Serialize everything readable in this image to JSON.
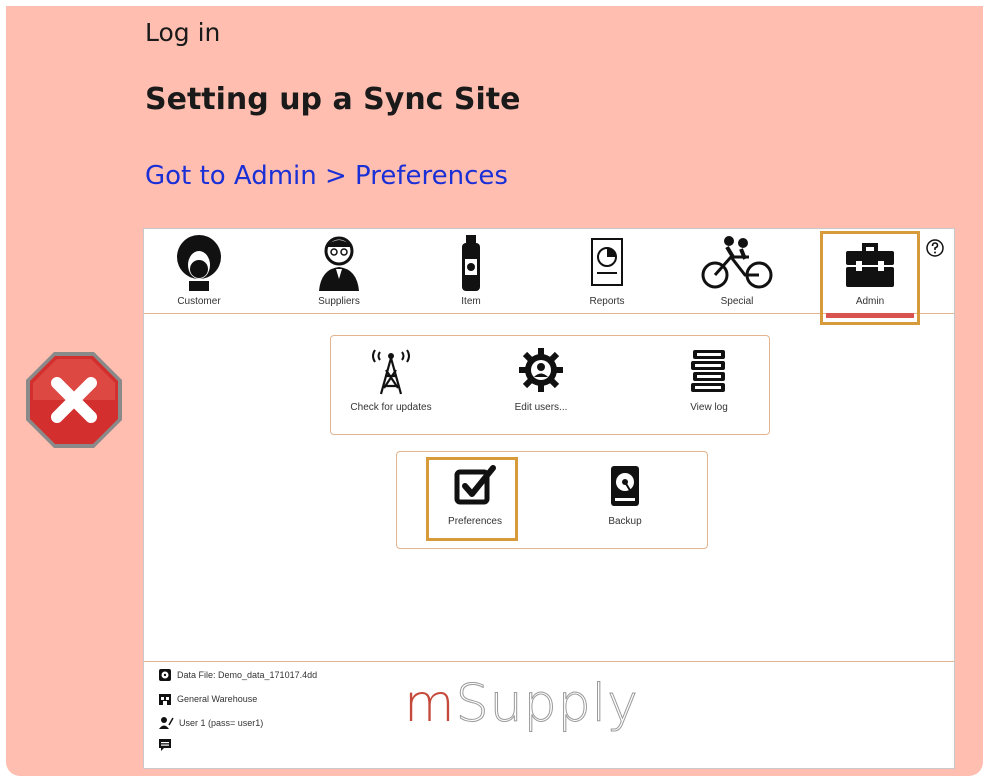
{
  "notice": {
    "title": "Log in",
    "heading": "Setting up a Sync Site",
    "link_text": "Got to Admin > Preferences",
    "colors": {
      "background": "#ffbeb0",
      "link": "#1a2fd6",
      "error": "#d32f2f"
    }
  },
  "app": {
    "toolbar": {
      "items": [
        {
          "label": "Customer",
          "icon": "customer-icon"
        },
        {
          "label": "Suppliers",
          "icon": "suppliers-icon"
        },
        {
          "label": "Item",
          "icon": "item-bottle-icon"
        },
        {
          "label": "Reports",
          "icon": "reports-icon"
        },
        {
          "label": "Special",
          "icon": "bicycle-icon"
        },
        {
          "label": "Admin",
          "icon": "toolbox-icon"
        }
      ],
      "selected": "Admin",
      "help_icon": "help-icon",
      "highlight_color": "#d79b3c"
    },
    "admin_groups": [
      {
        "items": [
          {
            "label": "Check for updates",
            "icon": "antenna-icon"
          },
          {
            "label": "Edit users...",
            "icon": "gear-user-icon"
          },
          {
            "label": "View log",
            "icon": "books-icon"
          }
        ]
      },
      {
        "items": [
          {
            "label": "Preferences",
            "icon": "checkbox-icon"
          },
          {
            "label": "Backup",
            "icon": "hard-drive-icon"
          }
        ]
      }
    ],
    "footer": {
      "data_file": "Data File: Demo_data_171017.4dd",
      "store": "General Warehouse",
      "user": "User 1 (pass= user1)",
      "brand_m": "m",
      "brand_rest": "Supply"
    }
  }
}
